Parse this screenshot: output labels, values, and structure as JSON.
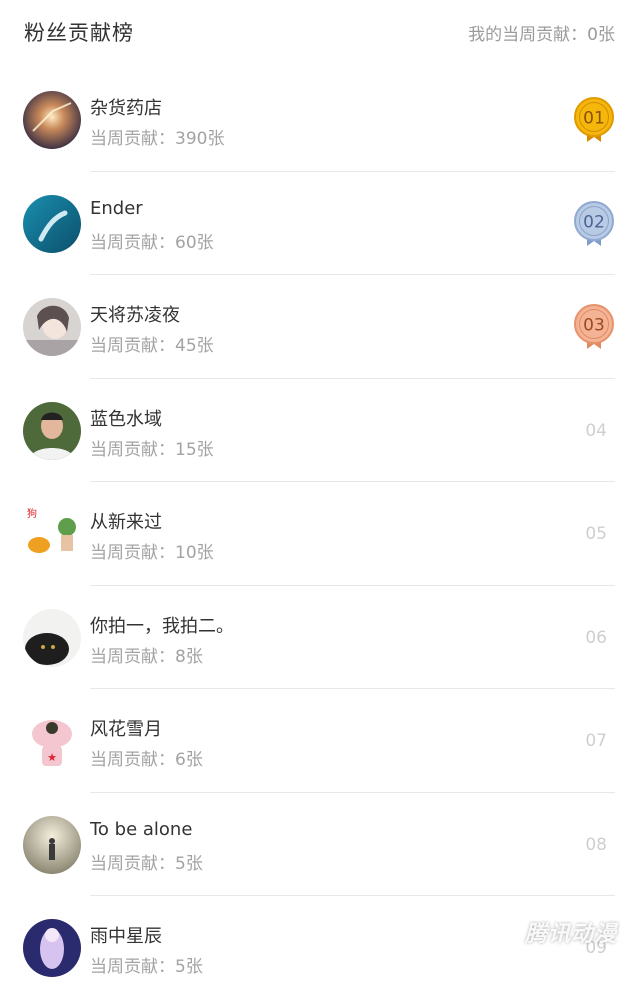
{
  "header": {
    "title": "粉丝贡献榜",
    "my_contribution": "我的当周贡献：0张"
  },
  "colors": {
    "gold": "#f5b70b",
    "silver": "#9fb6d6",
    "bronze": "#f0a37f",
    "rank_text": "#cfcfcf",
    "secondary_text": "#a3a3a3"
  },
  "rows": [
    {
      "name": "杂货药店",
      "contribution": "当周贡献：390张",
      "rank": "01",
      "medal": "gold-medal"
    },
    {
      "name": "Ender",
      "contribution": "当周贡献：60张",
      "rank": "02",
      "medal": "silver-medal"
    },
    {
      "name": "天将苏凌夜",
      "contribution": "当周贡献：45张",
      "rank": "03",
      "medal": "bronze-medal"
    },
    {
      "name": "蓝色水域",
      "contribution": "当周贡献：15张",
      "rank": "04"
    },
    {
      "name": "从新来过",
      "contribution": "当周贡献：10张",
      "rank": "05"
    },
    {
      "name": "你拍一，我拍二。",
      "contribution": "当周贡献：8张",
      "rank": "06"
    },
    {
      "name": "风花雪月",
      "contribution": "当周贡献：6张",
      "rank": "07"
    },
    {
      "name": "To be alone",
      "contribution": "当周贡献：5张",
      "rank": "08"
    },
    {
      "name": "雨中星辰",
      "contribution": "当周贡献：5张",
      "rank": "09"
    }
  ],
  "watermark": "腾讯动漫"
}
